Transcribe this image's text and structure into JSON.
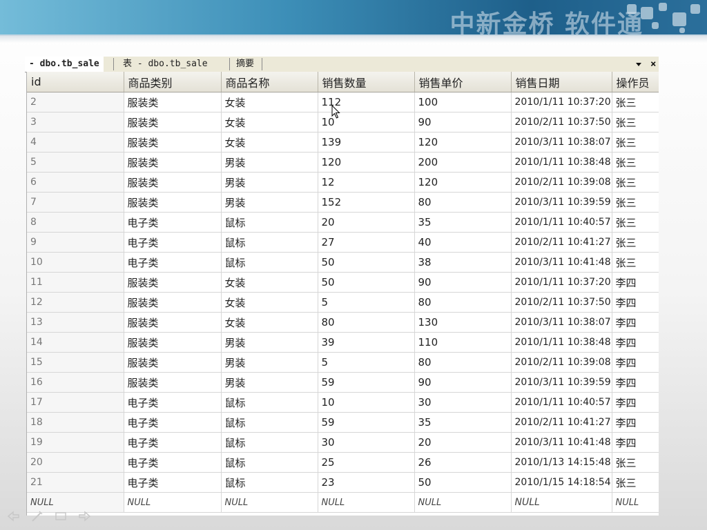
{
  "banner": {
    "brand": "中新金桥 软件通"
  },
  "tabs": [
    {
      "label": "- dbo.tb_sale",
      "active": true
    },
    {
      "label": "表 - dbo.tb_sale",
      "active": false
    },
    {
      "label": "摘要",
      "active": false
    }
  ],
  "tab_controls": {
    "menu_icon": "triangle-down-icon",
    "close": "×"
  },
  "table": {
    "columns": [
      "id",
      "商品类别",
      "商品名称",
      "销售数量",
      "销售单价",
      "销售日期",
      "操作员"
    ],
    "rows": [
      [
        "2",
        "服装类",
        "女装",
        "112",
        "100",
        "2010/1/11 10:37:20",
        "张三"
      ],
      [
        "3",
        "服装类",
        "女装",
        "10",
        "90",
        "2010/2/11 10:37:50",
        "张三"
      ],
      [
        "4",
        "服装类",
        "女装",
        "139",
        "120",
        "2010/3/11 10:38:07",
        "张三"
      ],
      [
        "5",
        "服装类",
        "男装",
        "120",
        "200",
        "2010/1/11 10:38:48",
        "张三"
      ],
      [
        "6",
        "服装类",
        "男装",
        "12",
        "120",
        "2010/2/11 10:39:08",
        "张三"
      ],
      [
        "7",
        "服装类",
        "男装",
        "152",
        "80",
        "2010/3/11 10:39:59",
        "张三"
      ],
      [
        "8",
        "电子类",
        "鼠标",
        "20",
        "35",
        "2010/1/11 10:40:57",
        "张三"
      ],
      [
        "9",
        "电子类",
        "鼠标",
        "27",
        "40",
        "2010/2/11 10:41:27",
        "张三"
      ],
      [
        "10",
        "电子类",
        "鼠标",
        "50",
        "38",
        "2010/3/11 10:41:48",
        "张三"
      ],
      [
        "11",
        "服装类",
        "女装",
        "50",
        "90",
        "2010/1/11 10:37:20",
        "李四"
      ],
      [
        "12",
        "服装类",
        "女装",
        "5",
        "80",
        "2010/2/11 10:37:50",
        "李四"
      ],
      [
        "13",
        "服装类",
        "女装",
        "80",
        "130",
        "2010/3/11 10:38:07",
        "李四"
      ],
      [
        "14",
        "服装类",
        "男装",
        "39",
        "110",
        "2010/1/11 10:38:48",
        "李四"
      ],
      [
        "15",
        "服装类",
        "男装",
        "5",
        "80",
        "2010/2/11 10:39:08",
        "李四"
      ],
      [
        "16",
        "服装类",
        "男装",
        "59",
        "90",
        "2010/3/11 10:39:59",
        "李四"
      ],
      [
        "17",
        "电子类",
        "鼠标",
        "10",
        "30",
        "2010/1/11 10:40:57",
        "李四"
      ],
      [
        "18",
        "电子类",
        "鼠标",
        "59",
        "35",
        "2010/2/11 10:41:27",
        "李四"
      ],
      [
        "19",
        "电子类",
        "鼠标",
        "30",
        "20",
        "2010/3/11 10:41:48",
        "李四"
      ],
      [
        "20",
        "电子类",
        "鼠标",
        "25",
        "26",
        "2010/1/13 14:15:48",
        "张三"
      ],
      [
        "21",
        "电子类",
        "鼠标",
        "23",
        "50",
        "2010/1/15 14:18:54",
        "张三"
      ],
      [
        "NULL",
        "NULL",
        "NULL",
        "NULL",
        "NULL",
        "NULL",
        "NULL"
      ]
    ]
  },
  "slide_nav": [
    "prev-arrow-icon",
    "pen-icon",
    "menu-icon",
    "next-arrow-icon"
  ],
  "colors": {
    "banner_dark": "#1e5f8a",
    "banner_light": "#74bcd9",
    "tab_bg": "#ece9d8"
  }
}
